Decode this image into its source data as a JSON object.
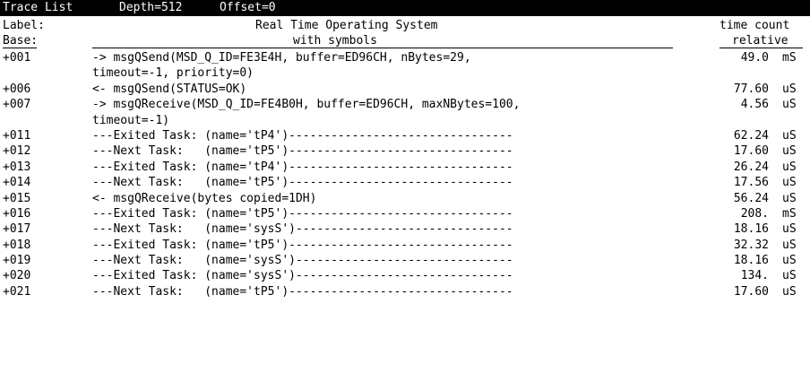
{
  "title_bar": {
    "title": "Trace List",
    "depth": "Depth=512",
    "offset": "Offset=0"
  },
  "header": {
    "label_line1": "Label:",
    "label_line2": "Base:",
    "desc_line1": "Real Time Operating System",
    "desc_line2": "with symbols",
    "time_line1": "time count",
    "time_line2": "relative"
  },
  "rows": [
    {
      "label": "+001",
      "text": "-> msgQSend(MSD_Q_ID=FE3E4H, buffer=ED96CH, nBytes=29,",
      "value": "49.0",
      "unit": "mS"
    },
    {
      "label": "",
      "text": "timeout=-1, priority=0)",
      "value": "",
      "unit": ""
    },
    {
      "label": "+006",
      "text": "<- msgQSend(STATUS=OK)",
      "value": "77.60",
      "unit": "uS"
    },
    {
      "label": "+007",
      "text": "-> msgQReceive(MSD_Q_ID=FE4B0H, buffer=ED96CH, maxNBytes=100,",
      "value": "4.56",
      "unit": "uS"
    },
    {
      "label": "",
      "text": "timeout=-1)",
      "value": "",
      "unit": ""
    },
    {
      "label": "+011",
      "text": "---Exited Task: (name='tP4')--------------------------------",
      "value": "62.24",
      "unit": "uS"
    },
    {
      "label": "+012",
      "text": "---Next Task:   (name='tP5')--------------------------------",
      "value": "17.60",
      "unit": "uS"
    },
    {
      "label": "+013",
      "text": "---Exited Task: (name='tP4')--------------------------------",
      "value": "26.24",
      "unit": "uS"
    },
    {
      "label": "+014",
      "text": "---Next Task:   (name='tP5')--------------------------------",
      "value": "17.56",
      "unit": "uS"
    },
    {
      "label": "+015",
      "text": "<- msgQReceive(bytes copied=1DH)",
      "value": "56.24",
      "unit": "uS"
    },
    {
      "label": "+016",
      "text": "---Exited Task: (name='tP5')--------------------------------",
      "value": "208.",
      "unit": "mS"
    },
    {
      "label": "+017",
      "text": "---Next Task:   (name='sysS')-------------------------------",
      "value": "18.16",
      "unit": "uS"
    },
    {
      "label": "+018",
      "text": "---Exited Task: (name='tP5')--------------------------------",
      "value": "32.32",
      "unit": "uS"
    },
    {
      "label": "+019",
      "text": "---Next Task:   (name='sysS')-------------------------------",
      "value": "18.16",
      "unit": "uS"
    },
    {
      "label": "+020",
      "text": "---Exited Task: (name='sysS')-------------------------------",
      "value": "134.",
      "unit": "uS"
    },
    {
      "label": "+021",
      "text": "---Next Task:   (name='tP5')--------------------------------",
      "value": "17.60",
      "unit": "uS"
    }
  ]
}
